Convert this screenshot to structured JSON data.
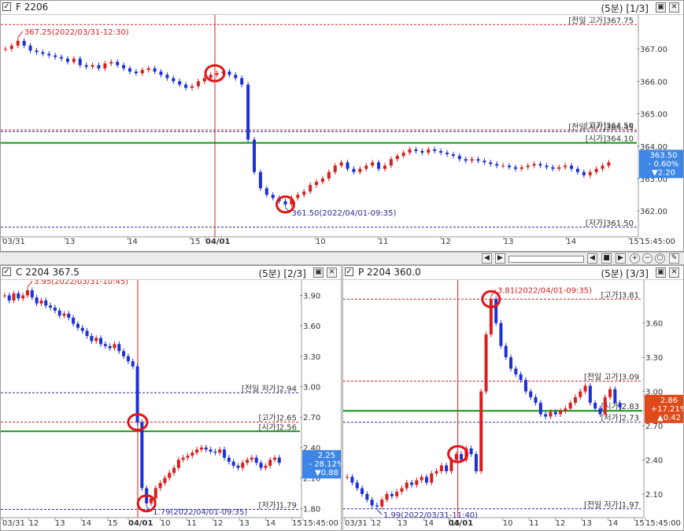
{
  "colors": {
    "up": "#d81e1e",
    "down": "#1d2fd6",
    "green": "#129612",
    "red_circle": "#e01515",
    "badge_down": "#3d86e6",
    "badge_up": "#e04a1a",
    "blue_dash": "#2a2a9a",
    "red_dash": "#c82828"
  },
  "icons": [
    "checkbox-icon",
    "restore-icon",
    "close-icon",
    "zoom-in-icon",
    "zoom-out-icon",
    "zoom-reset-icon",
    "settings-icon",
    "play-icon",
    "stop-icon",
    "step-icon",
    "scroll-left-icon",
    "scroll-right-icon"
  ],
  "panes": [
    {
      "title": "F 2206",
      "period": "(5분)",
      "index": "[1/3]",
      "badge": {
        "value": "363.50",
        "pct": "- 0.60%",
        "chg": "▼2.20",
        "style": "down"
      },
      "time_axis": {
        "labels": [
          "03/31",
          "13",
          "14",
          "15",
          "04/01",
          "10",
          "11",
          "12",
          "13",
          "14",
          "15",
          "15:45:00"
        ],
        "bold": "04/01"
      },
      "annotations": {
        "high": "367.25(2022/03/31-12:30)",
        "low": "361.50(2022/04/01-09:35)"
      },
      "levels": [
        {
          "label": "[전일 고가]367.75",
          "value": 367.75,
          "color": "red",
          "dash": true
        },
        {
          "label": "[고가]364.50",
          "value": 364.5,
          "color": "red",
          "dash": true
        },
        {
          "label": "[전일 저가]364.45",
          "value": 364.45,
          "color": "blue",
          "dash": true
        },
        {
          "label": "[시가]364.10",
          "value": 364.1,
          "color": "green",
          "dash": false
        },
        {
          "label": "[저가]361.50",
          "value": 361.5,
          "color": "blue",
          "dash": true
        }
      ]
    },
    {
      "title": "C 2204 367.5",
      "period": "(5분)",
      "index": "[2/3]",
      "badge": {
        "value": "2.25",
        "pct": "- 28.12%",
        "chg": "▼0.88",
        "style": "down"
      },
      "time_axis": {
        "labels": [
          "03/31",
          "12",
          "13",
          "14",
          "15",
          "04/01",
          "10",
          "11",
          "12",
          "13",
          "14",
          "15",
          "15:45:00"
        ],
        "bold": "04/01"
      },
      "annotations": {
        "high": "3.95(2022/03/31-10:45)",
        "low": "1.79(2022/04/01-09:35)"
      },
      "levels": [
        {
          "label": "[전일 저가]2.94",
          "value": 2.94,
          "color": "blue",
          "dash": true
        },
        {
          "label": "[고가]2.65",
          "value": 2.65,
          "color": "red",
          "dash": true
        },
        {
          "label": "[시가]2.56",
          "value": 2.56,
          "color": "green",
          "dash": false
        },
        {
          "label": "[저가]1.79",
          "value": 1.79,
          "color": "blue",
          "dash": true
        }
      ]
    },
    {
      "title": "P 2204 360.0",
      "period": "(5분)",
      "index": "[3/3]",
      "badge": {
        "value": "2.86",
        "pct": "+17.21%",
        "chg": "▲0.42",
        "style": "up"
      },
      "time_axis": {
        "labels": [
          "03/31",
          "12",
          "13",
          "14",
          "15",
          "04/01",
          "10",
          "11",
          "12",
          "13",
          "14",
          "15",
          "15:45:00"
        ],
        "bold": "04/01"
      },
      "annotations": {
        "high": "3.81(2022/04/01-09:35)",
        "low": "1.99(2022/03/31-11:40)"
      },
      "levels": [
        {
          "label": "[고가]3.81",
          "value": 3.81,
          "color": "red",
          "dash": true
        },
        {
          "label": "[전일 고가]3.09",
          "value": 3.09,
          "color": "red",
          "dash": true
        },
        {
          "label": "[시가]2.83",
          "value": 2.83,
          "color": "green",
          "dash": false
        },
        {
          "label": "[저가]2.73",
          "value": 2.73,
          "color": "blue",
          "dash": true
        },
        {
          "label": "[전일 저가]1.97",
          "value": 1.97,
          "color": "blue",
          "dash": true
        }
      ]
    }
  ],
  "chart_data": [
    {
      "type": "candlestick",
      "title": "F 2206",
      "ylim": [
        361.3,
        368.0
      ],
      "yticks": [
        "367.00",
        "366.00",
        "365.00",
        "364.00",
        "363.00",
        "362.00"
      ],
      "series": [
        {
          "values": [
            367.0,
            367.1,
            367.25,
            367.1,
            366.95,
            366.9,
            366.85,
            366.8,
            366.75,
            366.7,
            366.6,
            366.7,
            366.5,
            366.45,
            366.5,
            366.4,
            366.55,
            366.6,
            366.5,
            366.4,
            366.3,
            366.25,
            366.35,
            366.4,
            366.3,
            366.2,
            366.1,
            366.0,
            365.9,
            365.8,
            365.85,
            366.0,
            366.1,
            366.2,
            366.25,
            366.3,
            366.2,
            366.1,
            365.9,
            364.2,
            363.2,
            362.7,
            362.5,
            362.4,
            362.3,
            362.2,
            362.4,
            362.5,
            362.6,
            362.8,
            362.9,
            363.0,
            363.2,
            363.4,
            363.5,
            363.3,
            363.2,
            363.3,
            363.4,
            363.5,
            363.3,
            363.4,
            363.6,
            363.7,
            363.8,
            363.9,
            363.85,
            363.8,
            363.9,
            363.85,
            363.8,
            363.75,
            363.7,
            363.6,
            363.55,
            363.6,
            363.55,
            363.5,
            363.45,
            363.4,
            363.4,
            363.35,
            363.3,
            363.35,
            363.4,
            363.45,
            363.4,
            363.35,
            363.3,
            363.35,
            363.4,
            363.3,
            363.2,
            363.1,
            363.2,
            363.3,
            363.4,
            363.5
          ]
        }
      ]
    },
    {
      "type": "candlestick",
      "title": "C 2204 367.5",
      "ylim": [
        1.74,
        4.02
      ],
      "yticks": [
        "3.90",
        "3.60",
        "3.30",
        "3.00",
        "2.70",
        "2.40",
        "2.10",
        "1.80"
      ],
      "series": [
        {
          "values": [
            3.9,
            3.85,
            3.92,
            3.87,
            3.9,
            3.95,
            3.88,
            3.82,
            3.85,
            3.8,
            3.78,
            3.75,
            3.7,
            3.72,
            3.68,
            3.62,
            3.58,
            3.55,
            3.5,
            3.45,
            3.48,
            3.42,
            3.4,
            3.38,
            3.42,
            3.35,
            3.3,
            3.25,
            3.2,
            2.65,
            2.0,
            1.85,
            1.9,
            2.0,
            2.05,
            2.1,
            2.15,
            2.2,
            2.28,
            2.3,
            2.32,
            2.35,
            2.38,
            2.4,
            2.38,
            2.36,
            2.35,
            2.38,
            2.3,
            2.26,
            2.22,
            2.2,
            2.25,
            2.28,
            2.3,
            2.25,
            2.2,
            2.22,
            2.28,
            2.3,
            2.25
          ]
        }
      ]
    },
    {
      "type": "candlestick",
      "title": "P 2204 360.0",
      "ylim": [
        1.92,
        3.95
      ],
      "yticks": [
        "3.60",
        "3.30",
        "3.00",
        "2.70",
        "2.40",
        "2.10"
      ],
      "series": [
        {
          "values": [
            2.25,
            2.2,
            2.15,
            2.1,
            2.05,
            2.0,
            1.99,
            2.05,
            2.1,
            2.08,
            2.12,
            2.15,
            2.2,
            2.18,
            2.22,
            2.25,
            2.2,
            2.28,
            2.3,
            2.35,
            2.3,
            2.4,
            2.45,
            2.4,
            2.5,
            2.45,
            2.3,
            3.0,
            3.5,
            3.81,
            3.6,
            3.4,
            3.3,
            3.2,
            3.15,
            3.1,
            3.0,
            2.95,
            2.9,
            2.8,
            2.78,
            2.82,
            2.8,
            2.83,
            2.85,
            2.9,
            2.95,
            3.0,
            3.05,
            2.9,
            2.85,
            2.8,
            2.95,
            3.02,
            2.9,
            2.86
          ]
        }
      ]
    }
  ]
}
